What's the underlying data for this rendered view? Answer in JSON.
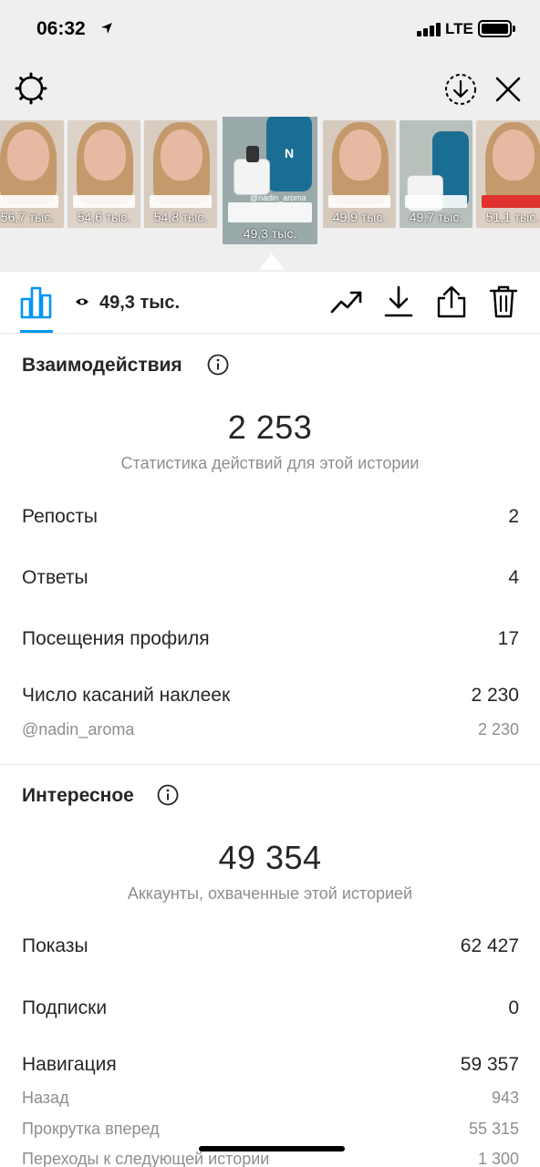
{
  "status_bar": {
    "time": "06:32",
    "network": "LTE"
  },
  "stories": [
    {
      "views": "56,7 тыс."
    },
    {
      "views": "54,6 тыс."
    },
    {
      "views": "54,8 тыс."
    },
    {
      "views": "49,3 тыс.",
      "tag": "@nadin_aroma"
    },
    {
      "views": "49,9 тыс."
    },
    {
      "views": "49,7 тыс."
    },
    {
      "views": "51,1 тыс."
    }
  ],
  "tab_bar": {
    "views": "49,3 тыс."
  },
  "interactions": {
    "title": "Взаимодействия",
    "total": "2 253",
    "caption": "Статистика действий для этой истории",
    "rows": [
      {
        "label": "Репосты",
        "value": "2"
      },
      {
        "label": "Ответы",
        "value": "4"
      },
      {
        "label": "Посещения профиля",
        "value": "17"
      },
      {
        "label": "Число касаний наклеек",
        "value": "2 230"
      }
    ],
    "sub_rows": [
      {
        "label": "@nadin_aroma",
        "value": "2 230"
      }
    ]
  },
  "discovery": {
    "title": "Интересное",
    "total": "49 354",
    "caption": "Аккаунты, охваченные этой историей",
    "rows": [
      {
        "label": "Показы",
        "value": "62 427"
      },
      {
        "label": "Подписки",
        "value": "0"
      },
      {
        "label": "Навигация",
        "value": "59 357"
      }
    ],
    "sub_rows": [
      {
        "label": "Назад",
        "value": "943"
      },
      {
        "label": "Прокрутка вперед",
        "value": "55 315"
      },
      {
        "label": "Переходы к следующей истории",
        "value": "1 300"
      }
    ]
  },
  "colors": {
    "accent": "#0095f6",
    "text": "#262626",
    "muted": "#8e8e8e",
    "header_bg": "#efefef"
  },
  "icons": [
    "gear-icon",
    "download-circle-icon",
    "close-icon",
    "chart-icon",
    "eye-icon",
    "trend-icon",
    "download-icon",
    "share-icon",
    "trash-icon",
    "info-icon"
  ]
}
